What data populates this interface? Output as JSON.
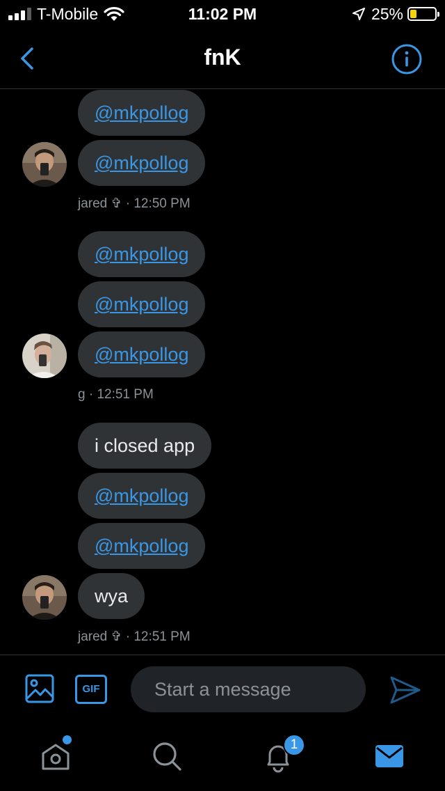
{
  "status_bar": {
    "carrier": "T-Mobile",
    "time": "11:02 PM",
    "battery_percent": "25%",
    "battery_level": 0.25,
    "signal_bars": 3
  },
  "header": {
    "title": "fnK",
    "back_icon": "chevron-left-icon",
    "info_icon": "info-icon"
  },
  "messages": [
    {
      "text": "@mkpollog",
      "is_link": true
    },
    {
      "text": "@mkpollog",
      "is_link": true
    },
    {
      "text": "@mkpollog",
      "is_link": true
    },
    {
      "text": "@mkpollog",
      "is_link": true
    },
    {
      "text": "@mkpollog",
      "is_link": true
    },
    {
      "text": "i closed app",
      "is_link": false
    },
    {
      "text": "@mkpollog",
      "is_link": true
    },
    {
      "text": "@mkpollog",
      "is_link": true
    },
    {
      "text": "wya",
      "is_link": false
    }
  ],
  "groups": [
    {
      "meta": "jared ✞ · 12:50 PM"
    },
    {
      "meta": "g  · 12:51 PM"
    },
    {
      "meta": "jared ✞ · 12:51 PM"
    }
  ],
  "composer": {
    "placeholder": "Start a message",
    "gif_label": "GIF"
  },
  "tabbar": {
    "notifications_badge": "1",
    "tabs": [
      "home-icon",
      "search-icon",
      "bell-icon",
      "mail-icon"
    ]
  },
  "colors": {
    "accent": "#3a97e5",
    "bubble": "#2f3336",
    "meta_text": "#8b9298",
    "background": "#000000"
  }
}
